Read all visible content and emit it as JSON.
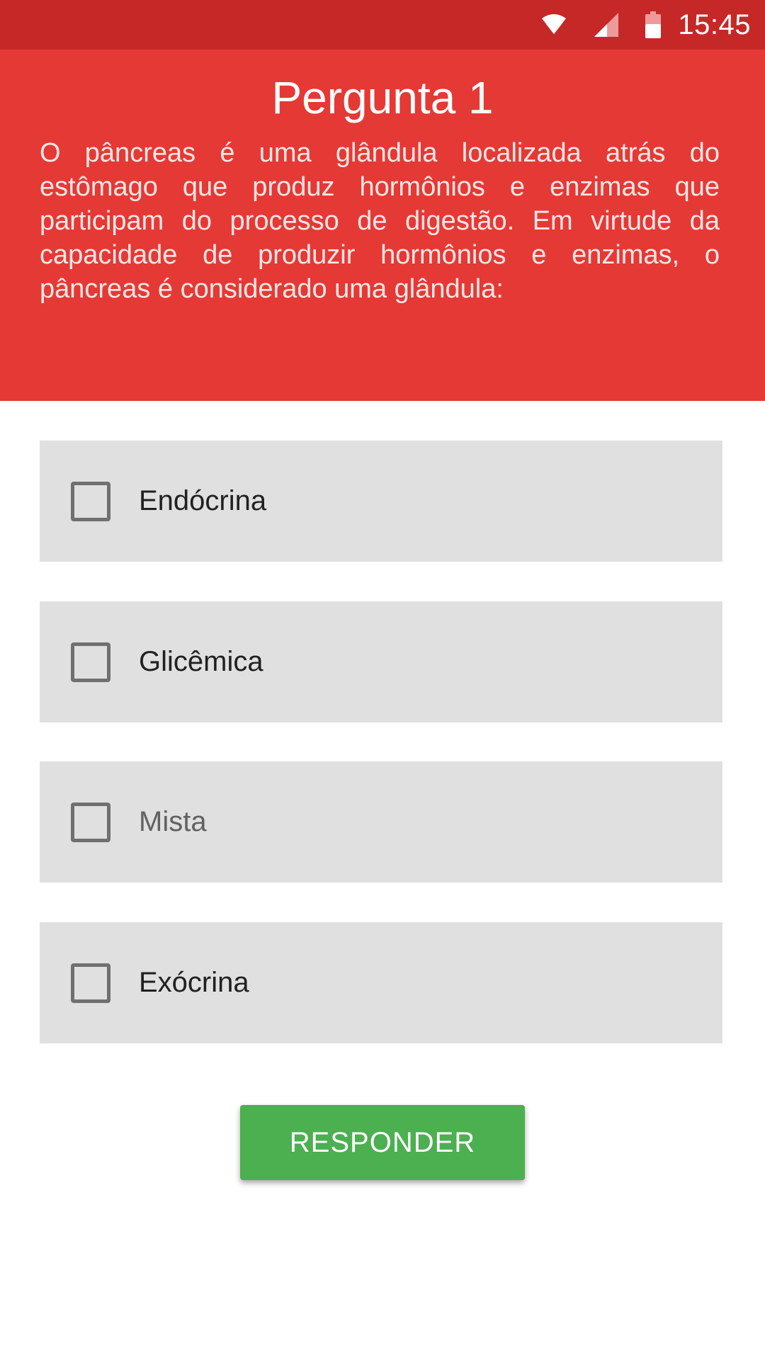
{
  "status_bar": {
    "time": "15:45",
    "icons": [
      "wifi-icon",
      "cell-signal-icon",
      "battery-icon"
    ]
  },
  "header": {
    "title": "Pergunta 1",
    "question": "O pâncreas é uma glândula localizada atrás do estômago que produz hormônios e enzimas que participam do processo de digestão. Em virtude da capacidade de produzir hormônios e enzimas, o pâncreas é considerado uma glândula:"
  },
  "options": [
    {
      "label": "Endócrina",
      "checked": false
    },
    {
      "label": "Glicêmica",
      "checked": false
    },
    {
      "label": "Mista",
      "checked": false
    },
    {
      "label": "Exócrina",
      "checked": false
    }
  ],
  "submit_label": "RESPONDER",
  "colors": {
    "status_bar": "#c62828",
    "header": "#e53935",
    "option_bg": "#e0e0e0",
    "button": "#4caf50"
  }
}
